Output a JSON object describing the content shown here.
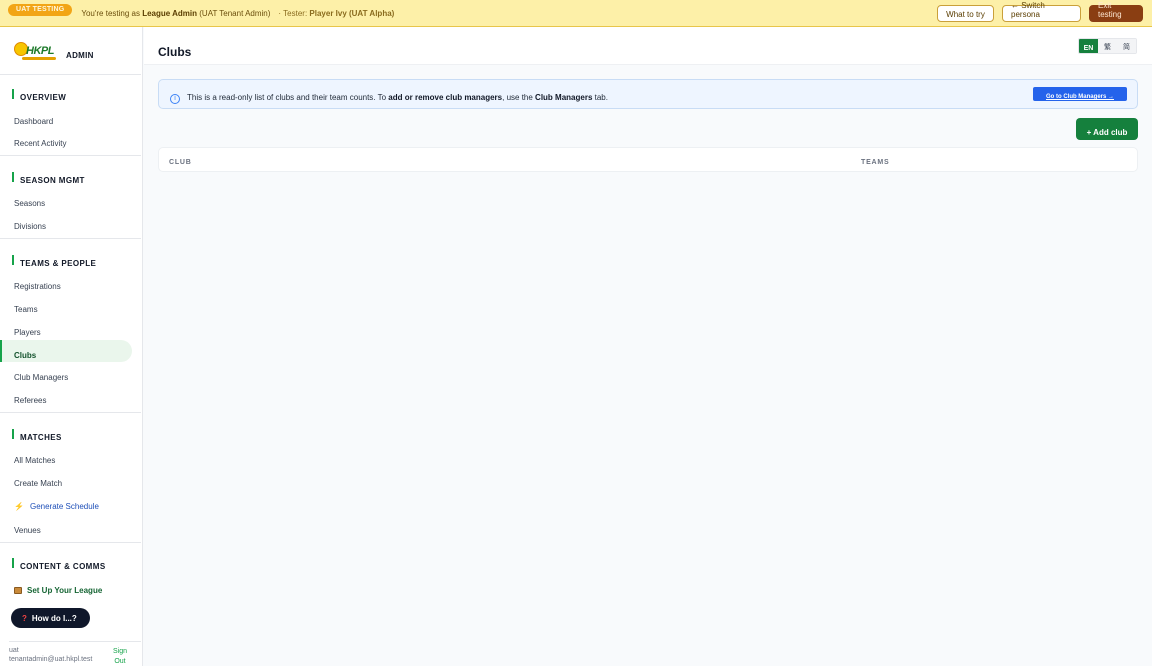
{
  "banner": {
    "pill": "UAT TESTING",
    "prefix": "You're testing as",
    "role": "League Admin",
    "role_note": "(UAT Tenant Admin)",
    "tester_prefix": "· Tester:",
    "tester": "Player Ivy (UAT Alpha)",
    "what_to_try": "What to try",
    "switch_persona": "← Switch persona",
    "exit_testing": "Exit testing"
  },
  "brand": {
    "logo_text": "HKPL",
    "admin_label": "ADMIN"
  },
  "sidebar": {
    "sections": [
      {
        "title": "OVERVIEW",
        "items": [
          "Dashboard",
          "Recent Activity"
        ]
      },
      {
        "title": "SEASON MGMT",
        "items": [
          "Seasons",
          "Divisions"
        ]
      },
      {
        "title": "TEAMS & PEOPLE",
        "items": [
          "Registrations",
          "Teams",
          "Players",
          "Clubs",
          "Club Managers",
          "Referees"
        ]
      },
      {
        "title": "MATCHES",
        "items": [
          "All Matches",
          "Create Match",
          "Generate Schedule",
          "Venues"
        ]
      },
      {
        "title": "CONTENT & COMMS",
        "items": [
          "Set Up Your League"
        ]
      }
    ],
    "active_item": "Clubs",
    "how_do_i": "How do I...?",
    "help_glyph": "?",
    "bolt_glyph": "⚡"
  },
  "footer": {
    "user_name": "uat",
    "user_email": "tenantadmin@uat.hkpl.test",
    "sign_out_1": "Sign",
    "sign_out_2": "Out"
  },
  "page": {
    "title": "Clubs"
  },
  "lang": {
    "en": "EN",
    "zh_trad": "繁",
    "zh_simp": "简",
    "selected": "EN"
  },
  "info": {
    "icon_glyph": "i",
    "text_1": "This is a read-only list of clubs and their team counts. To",
    "bold_1": "add or remove club managers",
    "text_2": ", use the",
    "bold_2": "Club Managers",
    "text_3": "tab.",
    "button": "Go to Club Managers →"
  },
  "actions": {
    "add_club": "+ Add club"
  },
  "table": {
    "columns": [
      "CLUB",
      "TEAMS"
    ],
    "rows": []
  },
  "colors": {
    "brand_green": "#15803d",
    "banner_bg": "#fdf0a8",
    "info_bg": "#eef5ff",
    "link_blue": "#2563eb"
  }
}
